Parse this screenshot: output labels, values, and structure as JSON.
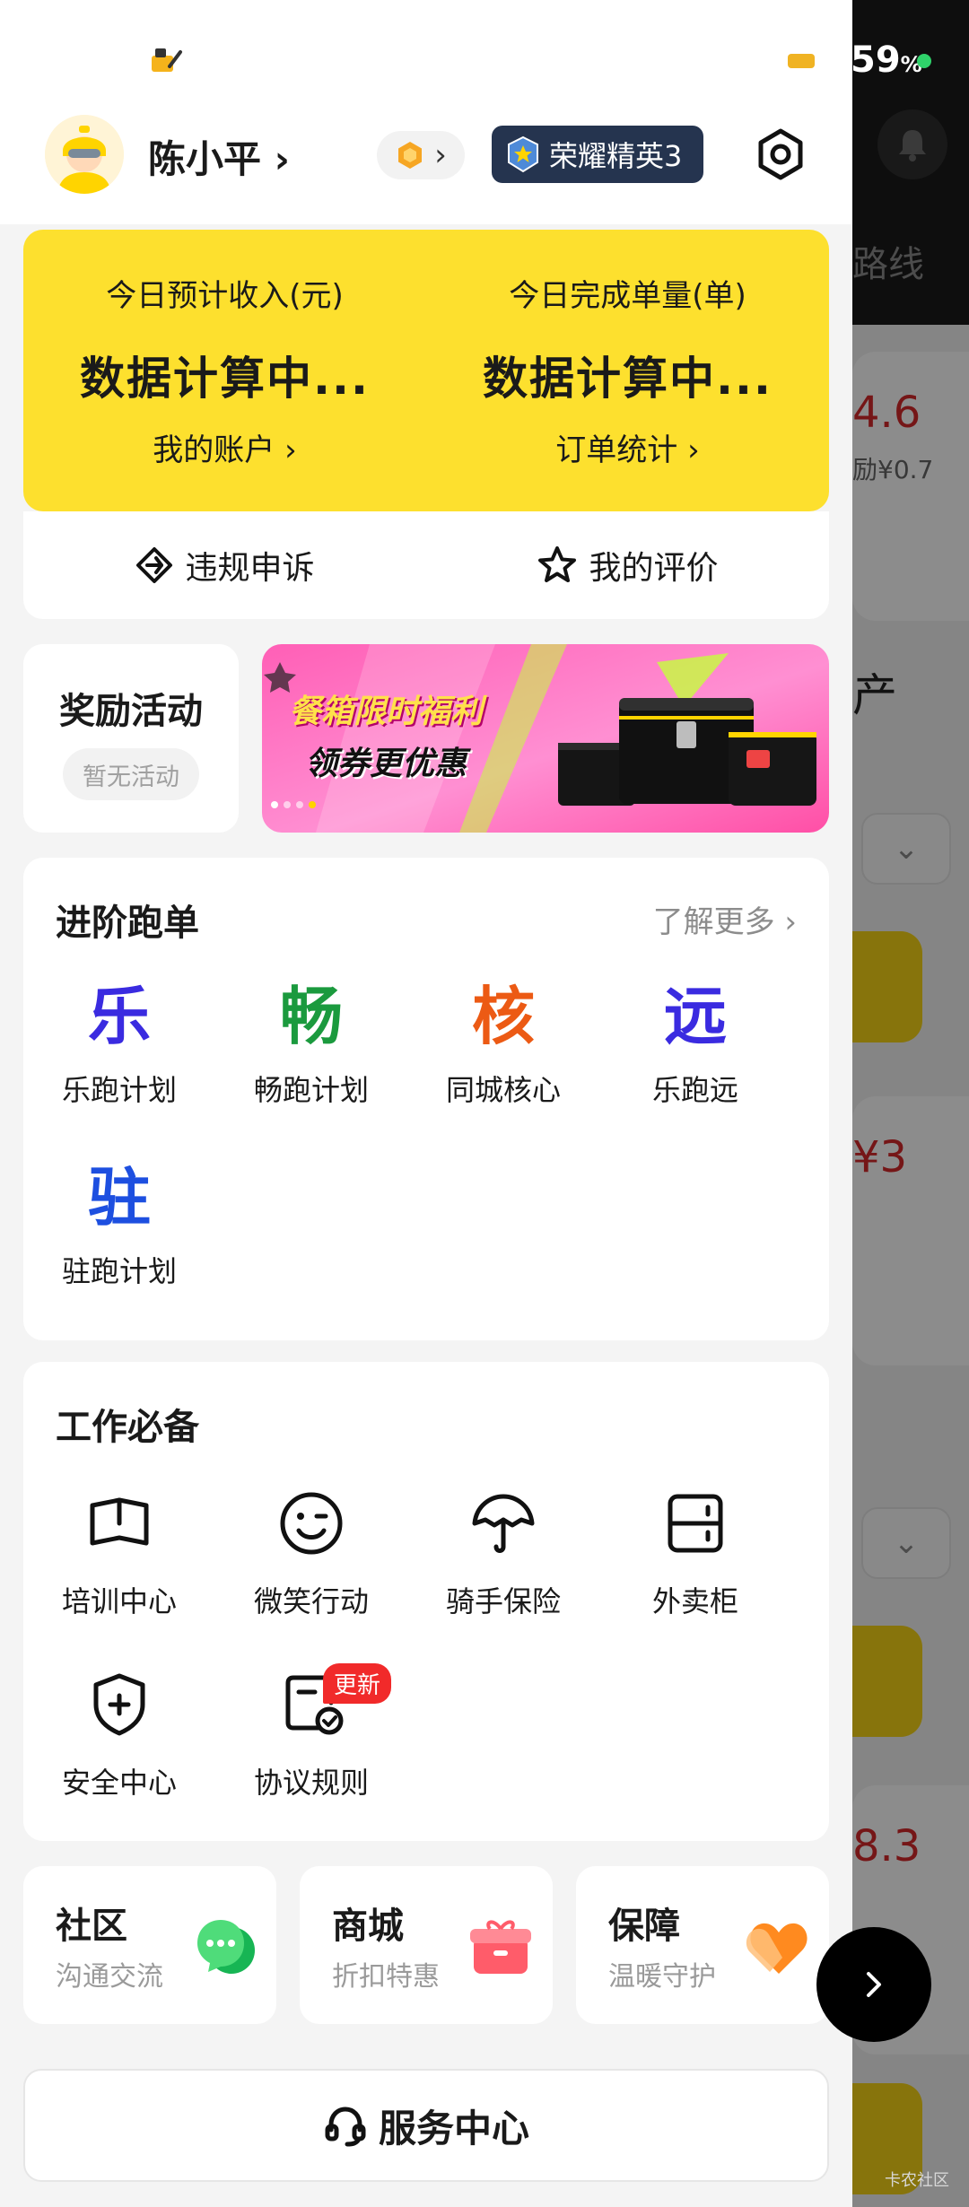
{
  "status_bar": {
    "battery_level": "59",
    "battery_unit": "%"
  },
  "profile": {
    "name": "陈小平",
    "name_chevron": "›",
    "coin_chevron": "›",
    "rank": "荣耀精英3"
  },
  "income": {
    "left": {
      "label": "今日预计收入(元)",
      "value": "数据计算中...",
      "link": "我的账户"
    },
    "right": {
      "label": "今日完成单量(单)",
      "value": "数据计算中...",
      "link": "订单统计"
    },
    "chevron": "›"
  },
  "actions": {
    "appeal": "违规申诉",
    "rating": "我的评价"
  },
  "reward": {
    "title": "奖励活动",
    "empty": "暂无活动"
  },
  "banner": {
    "line1": "餐箱限时福利",
    "line2": "领券更优惠"
  },
  "advanced": {
    "title": "进阶跑单",
    "more": "了解更多",
    "items": [
      {
        "char": "乐",
        "label": "乐跑计划",
        "color": "#3a2be0"
      },
      {
        "char": "畅",
        "label": "畅跑计划",
        "color": "#1b9a3e"
      },
      {
        "char": "核",
        "label": "同城核心",
        "color": "#ec5a14"
      },
      {
        "char": "远",
        "label": "乐跑远",
        "color": "#3a2be0"
      },
      {
        "char": "驻",
        "label": "驻跑计划",
        "color": "#1d4fe0"
      }
    ]
  },
  "tools": {
    "title": "工作必备",
    "items": [
      {
        "label": "培训中心",
        "icon": "book-icon"
      },
      {
        "label": "微笑行动",
        "icon": "smile-icon"
      },
      {
        "label": "骑手保险",
        "icon": "umbrella-icon"
      },
      {
        "label": "外卖柜",
        "icon": "locker-icon"
      },
      {
        "label": "安全中心",
        "icon": "shield-icon"
      },
      {
        "label": "协议规则",
        "icon": "document-check-icon",
        "badge": "更新"
      }
    ]
  },
  "mini_cards": [
    {
      "title": "社区",
      "sub": "沟通交流",
      "icon": "chat-bubble-icon"
    },
    {
      "title": "商城",
      "sub": "折扣特惠",
      "icon": "gift-box-icon"
    },
    {
      "title": "保障",
      "sub": "温暖守护",
      "icon": "heart-icon"
    }
  ],
  "service_center": {
    "label": "服务中心",
    "icon": "headset-icon"
  },
  "background_app": {
    "route_label": "路线",
    "values": [
      "4.6",
      "励¥0.7",
      "产",
      "¥3",
      "8.3"
    ]
  },
  "watermark": "卡农社区"
}
